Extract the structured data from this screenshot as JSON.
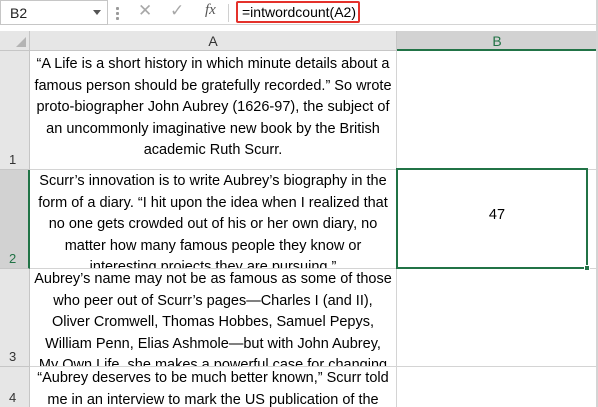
{
  "formula_bar": {
    "name_box": "B2",
    "cancel_icon": "close-icon",
    "enter_icon": "checkmark-icon",
    "function_label": "fx",
    "formula": "=intwordcount(A2)"
  },
  "columns": [
    {
      "label": "A"
    },
    {
      "label": "B"
    }
  ],
  "rows": [
    {
      "number": "1",
      "a_text": "“A Life is a short history in which minute details about a famous person should be gratefully recorded.” So wrote proto-biographer John Aubrey (1626-97), the subject of an uncommonly imaginative new book by the British academic Ruth Scurr.",
      "b_value": ""
    },
    {
      "number": "2",
      "a_text": "Scurr’s innovation is to write Aubrey’s biography in the form of a diary. “I hit upon the idea when I realized that no one gets crowded out of his or her own diary, no matter how many famous people they know or interesting projects they are pursuing.”",
      "b_value": "47"
    },
    {
      "number": "3",
      "a_text": "Aubrey’s name may not be as famous as some of those who peer out of Scurr’s pages—Charles I (and II), Oliver Cromwell, Thomas Hobbes, Samuel Pepys, William Penn, Elias Ashmole—but with John Aubrey, My Own Life, she makes a powerful case for changing that.",
      "b_value": ""
    },
    {
      "number": "4",
      "a_text": "“Aubrey deserves to be much better known,” Scurr told me in an interview to mark the US publication of the",
      "b_value": ""
    }
  ],
  "colors": {
    "selection": "#217346",
    "formula_highlight": "#e4312b",
    "header_bg": "#e6e6e6"
  }
}
